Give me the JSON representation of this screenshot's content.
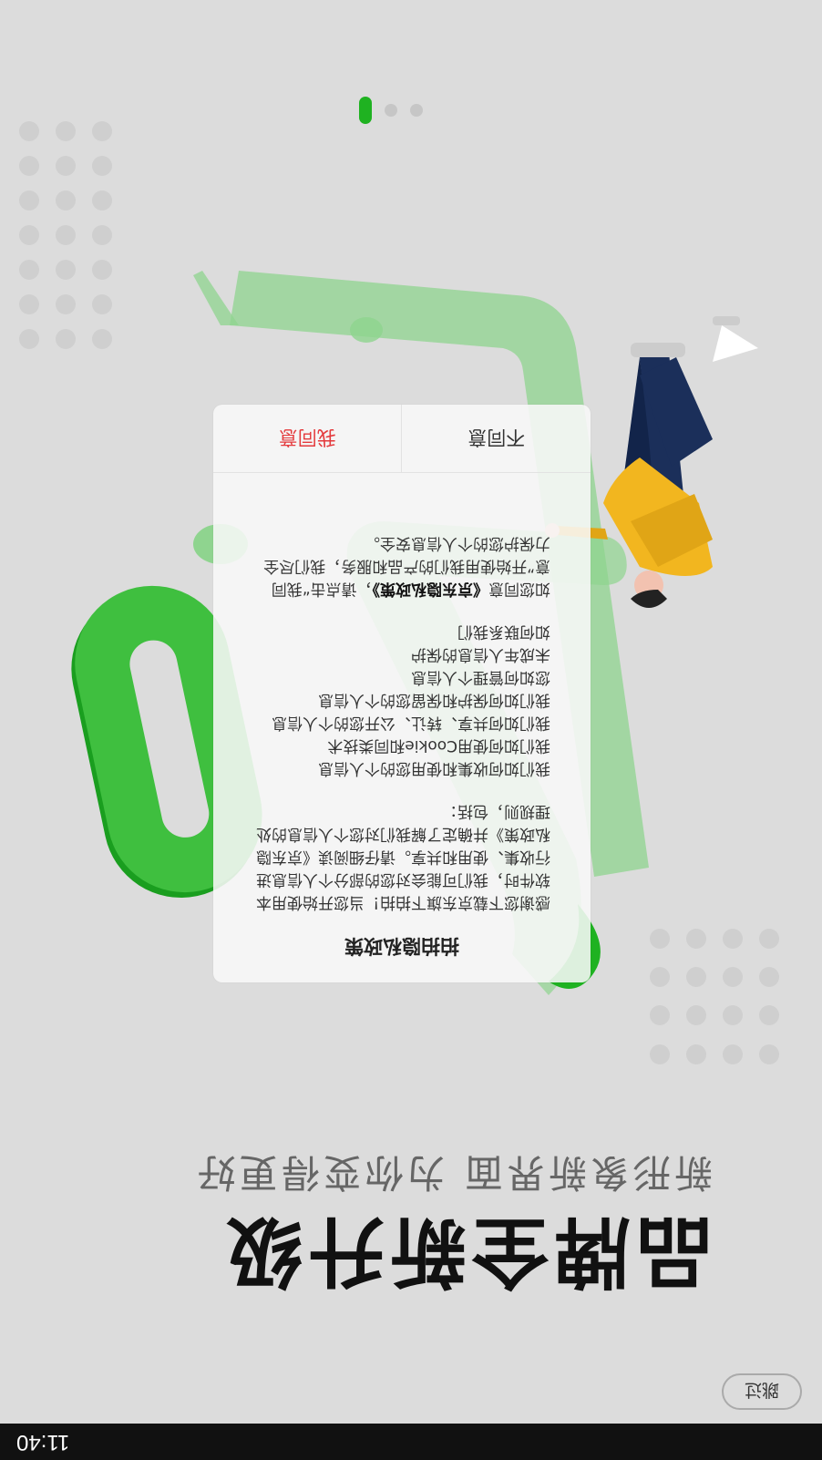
{
  "status_bar": {
    "time": "11:40"
  },
  "skip_label": "跳过",
  "headline": "品牌全新升级",
  "subline": "新形象新界面 为你变得更好",
  "pager": {
    "count": 3,
    "active_index": 2,
    "active_color": "#1fb221"
  },
  "dialog": {
    "title": "拍拍隐私政策",
    "intro": "感谢您下载京东旗下拍拍！当您开始使用本软件时，我们可能会对您的部分个人信息进行收集、使用和共享。请仔细阅读《京东隐私政策》并确定了解我们对您个人信息的处理规则，包括：",
    "items": [
      "我们如何收集和使用您的个人信息",
      "我们如何使用Cookie和同类技术",
      "我们如何共享、转让、公开您的个人信息",
      "我们如何保护和保留您的个人信息",
      "您如何管理个人信息",
      "未成年人信息的保护",
      "如何联系我们"
    ],
    "consent_prefix": "如您同意",
    "policy_link": "《京东隐私政策》",
    "consent_suffix": "，请点击“我同意”开始使用我们的产品和服务，我们尽全力保护您的个人信息安全。",
    "disagree_label": "不同意",
    "agree_label": "我同意"
  },
  "colors": {
    "accent_green": "#1fb221",
    "agree_red": "#e4393c",
    "background": "#dcdcdc"
  }
}
